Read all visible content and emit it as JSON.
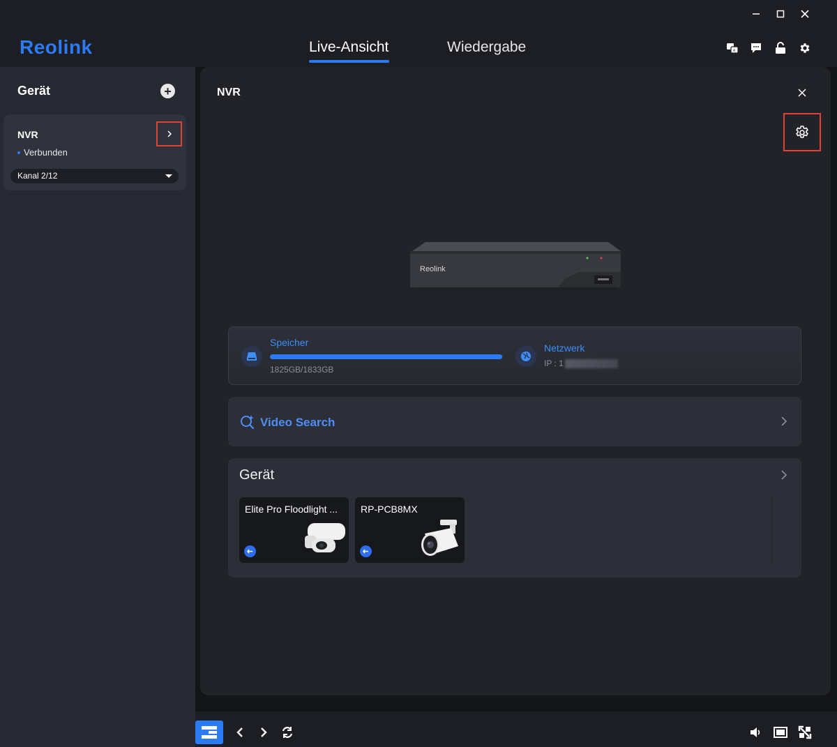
{
  "app": {
    "logo_text": "Reolink",
    "brand_color": "#2d7bf4",
    "window_controls": [
      "minimize-icon",
      "maximize-icon",
      "close-icon"
    ]
  },
  "header": {
    "tabs": [
      {
        "label": "Live-Ansicht",
        "active": true
      },
      {
        "label": "Wiedergabe",
        "active": false
      }
    ],
    "icons": [
      "translate-icon",
      "chat-icon",
      "unlock-icon",
      "gear-icon"
    ]
  },
  "sidebar": {
    "title": "Gerät",
    "device": {
      "name": "NVR",
      "status": "Verbunden",
      "channel": "Kanal 2/12"
    }
  },
  "panel": {
    "title": "NVR",
    "device_image_label": "Reolink",
    "storage": {
      "label": "Speicher",
      "size": "1825GB/1833GB",
      "used_fraction": 0.9956
    },
    "network": {
      "label": "Netzwerk",
      "ip": "IP : 1"
    },
    "video_search": {
      "label": "Video Search"
    },
    "devices_section": {
      "title": "Gerät",
      "cameras": [
        {
          "name": "Elite Pro Floodlight ..."
        },
        {
          "name": "RP-PCB8MX"
        }
      ]
    }
  },
  "bottom_toolbar": {
    "left": [
      "layout-icon",
      "prev-icon",
      "next-icon",
      "cycle-icon"
    ],
    "right": [
      "volume-icon",
      "screen-icon",
      "fullscreen-icon"
    ]
  }
}
